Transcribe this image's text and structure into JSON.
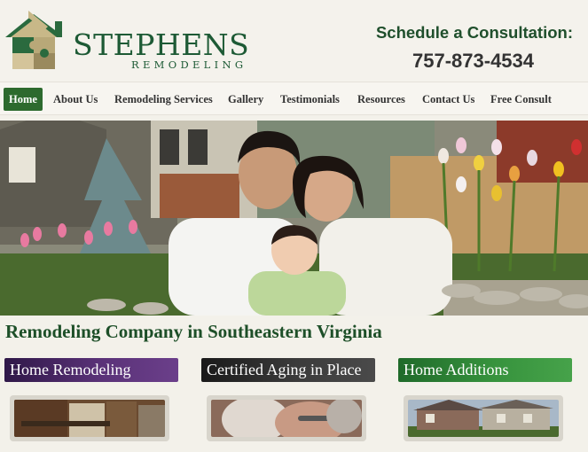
{
  "brand": {
    "name": "STEPHENS",
    "tagline": "REMODELING",
    "colors": {
      "green": "#1d5a35",
      "logo_tan": "#c9b98a"
    }
  },
  "contact": {
    "schedule_label": "Schedule a Consultation:",
    "phone": "757-873-4534"
  },
  "nav": {
    "items": [
      {
        "label": "Home",
        "active": true
      },
      {
        "label": "About Us"
      },
      {
        "label": "Remodeling Services"
      },
      {
        "label": "Gallery"
      },
      {
        "label": "Testimonials"
      },
      {
        "label": "Resources"
      },
      {
        "label": "Contact Us"
      },
      {
        "label": "Free Consult"
      }
    ]
  },
  "hero": {
    "subject": "family-photo"
  },
  "main": {
    "headline": "Remodeling Company in Southeastern Virginia",
    "services": [
      {
        "label": "Home Remodeling",
        "color": "#5a3278",
        "image": "kitchen-photo"
      },
      {
        "label": "Certified Aging in Place",
        "color": "#3b3b3b",
        "image": "elderly-couple-photo"
      },
      {
        "label": "Home Additions",
        "color": "#37933d",
        "image": "house-exterior-photo"
      }
    ]
  }
}
